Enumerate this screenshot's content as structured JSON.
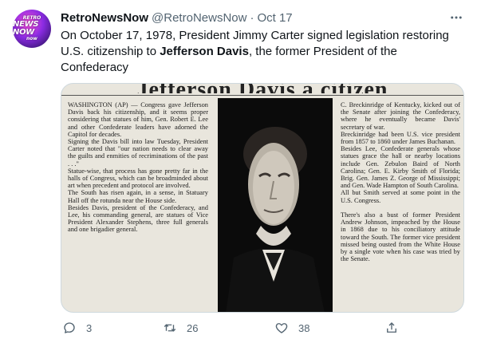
{
  "author": {
    "display_name": "RetroNewsNow",
    "handle": "@RetroNewsNow",
    "separator": "·",
    "date": "Oct 17",
    "avatar_text": [
      "RETRO",
      "NEWS NOW",
      "now"
    ]
  },
  "tweet": {
    "text_part1": "On October 17, 1978, President Jimmy Carter signed legislation restoring U.S. citizenship to ",
    "text_bold": "Jefferson Davis",
    "text_part2": ", the former President of the Confederacy"
  },
  "clipping": {
    "headline": "Jefferson Davis a citizen",
    "left_column": "WASHINGTON (AP) — Congress gave Jefferson Davis back his citizenship, and it seems proper considering that statues of him, Gen. Robert E. Lee and other Confederate leaders have adorned the Capitol for decades.\n  Signing the Davis bill into law Tuesday, President Carter noted that \"our nation needs to clear away the guilts and enmities of recriminations of the past . . .\"\n  Statue-wise, that process has gone pretty far in the halls of Congress, which can be broadminded about art when precedent and protocol are involved.\n  The South has risen again, in a sense, in Statuary Hall off the rotunda near the House side.\n  Besides Davis, president of the Confederacy, and Lee, his commanding general, are statues of Vice President Alexander Stephens, three full generals and one brigadier general.",
    "right_column": "C. Breckinridge of Kentucky, kicked out of the Senate after joining the Confederacy, where he eventually became Davis' secretary of war.\n  Breckinridge had been U.S. vice president from 1857 to 1860 under James Buchanan.\n  Besides Lee, Confederate generals whose statues grace the hall or nearby locations include Gen. Zebulon Baird of North Carolina; Gen. E. Kirby Smith of Florida; Brig. Gen. James Z. George of Mississippi; and Gen. Wade Hampton of South Carolina.\n  All but Smith served at some point in the U.S. Congress.\n\n  There's also a bust of former President Andrew Johnson, impeached by the House in 1868 due to his conciliatory attitude toward the South. The former vice president missed being ousted from the White House by a single vote when his case was tried by the Senate."
  },
  "actions": {
    "replies": "3",
    "retweets": "26",
    "likes": "38"
  }
}
